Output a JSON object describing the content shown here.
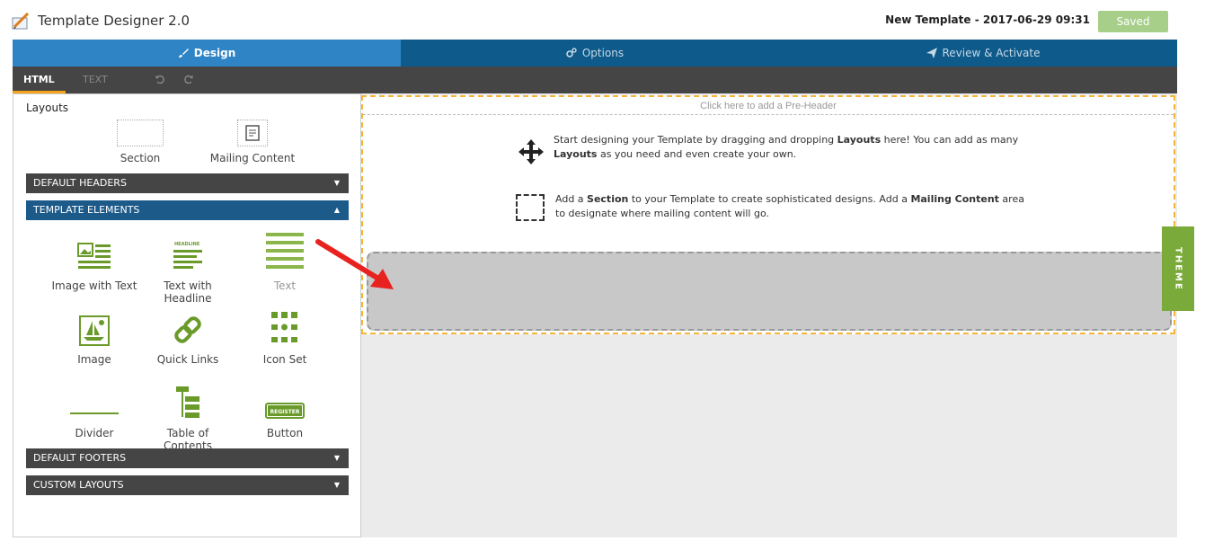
{
  "app": {
    "title": "Template Designer 2.0",
    "doc_title": "New Template - 2017-06-29 09:31",
    "saved_label": "Saved"
  },
  "tabs": [
    {
      "label": "Design"
    },
    {
      "label": "Options"
    },
    {
      "label": "Review & Activate"
    }
  ],
  "editor_tabs": {
    "html": "HTML",
    "text": "TEXT"
  },
  "sidebar": {
    "layouts_label": "Layouts",
    "layouts": [
      {
        "label": "Section"
      },
      {
        "label": "Mailing Content"
      }
    ],
    "accordions": {
      "default_headers": "DEFAULT HEADERS",
      "template_elements": "TEMPLATE ELEMENTS",
      "default_footers": "DEFAULT FOOTERS",
      "custom_layouts": "CUSTOM LAYOUTS"
    },
    "elements": [
      {
        "label": "Image with Text"
      },
      {
        "label": "Text with Headline"
      },
      {
        "label": "Text"
      },
      {
        "label": "Image"
      },
      {
        "label": "Quick Links"
      },
      {
        "label": "Icon Set"
      },
      {
        "label": "Divider"
      },
      {
        "label": "Table of Contents"
      },
      {
        "label": "Button"
      }
    ],
    "headline_tiny": "HEADLINE",
    "register_tiny": "REGISTER"
  },
  "canvas": {
    "preheader": "Click here to add a Pre-Header",
    "hint1_a": "Start designing your Template by dragging and dropping ",
    "hint1_b": "Layouts",
    "hint1_c": " here! You can add as many",
    "hint1_d": "Layouts",
    "hint1_e": " as you need and even create your own.",
    "hint2_a": "Add a ",
    "hint2_b": "Section",
    "hint2_c": " to your Template to create sophisticated designs. Add a ",
    "hint2_d": "Mailing Content",
    "hint2_e": " area",
    "hint2_f": "to designate where mailing content will go."
  },
  "theme_label": "THEME",
  "colors": {
    "accent_green": "#7aaa3a",
    "tab_blue": "#0e5a8a",
    "active_tab": "#2f84c6",
    "orange": "#f7a21b"
  }
}
